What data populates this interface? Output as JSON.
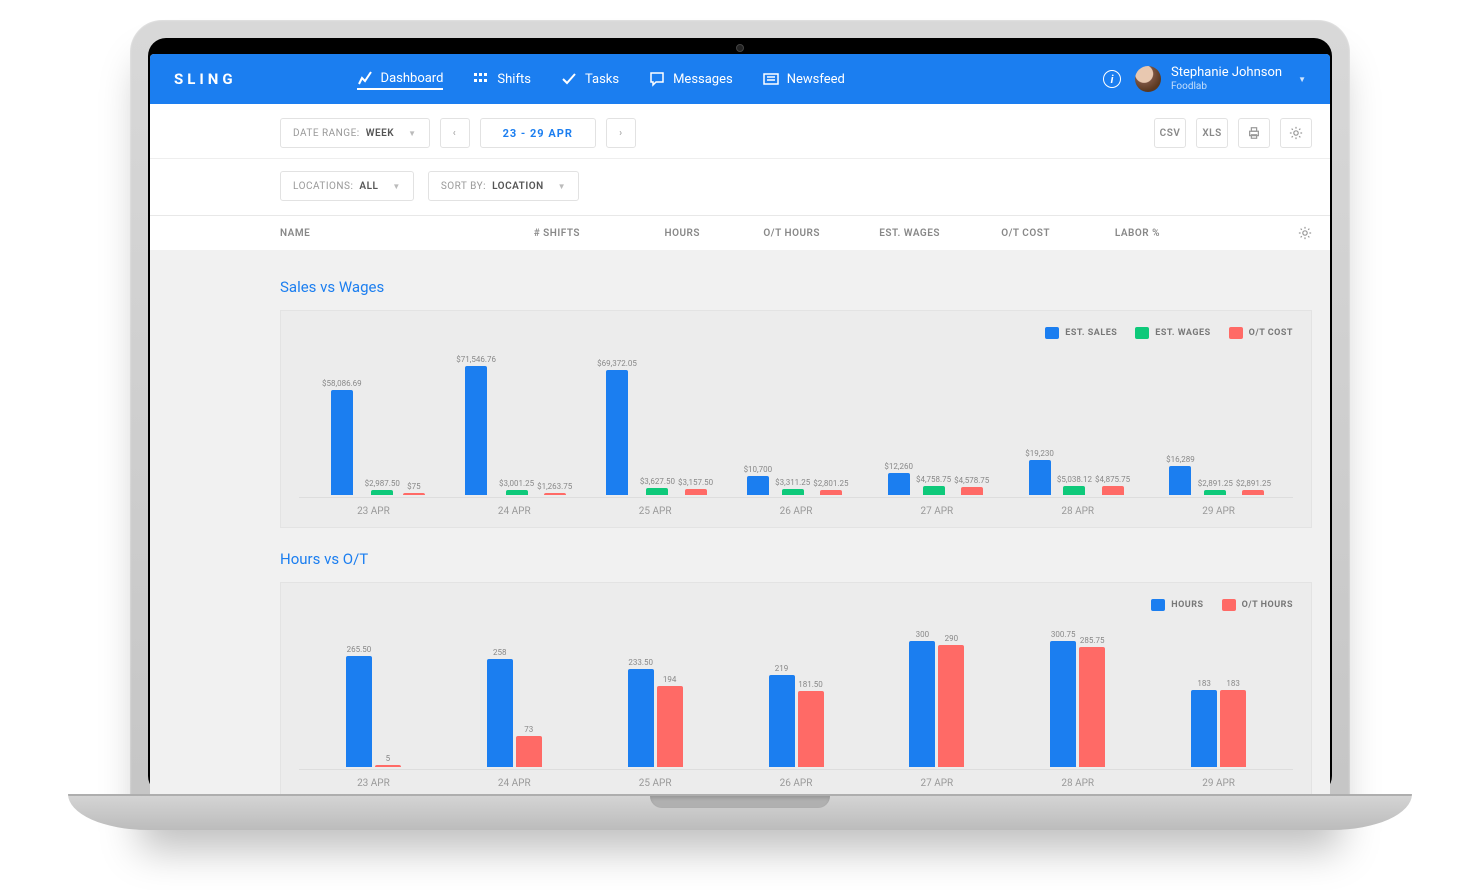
{
  "brand": "SLING",
  "nav": {
    "dashboard": "Dashboard",
    "shifts": "Shifts",
    "tasks": "Tasks",
    "messages": "Messages",
    "newsfeed": "Newsfeed"
  },
  "user": {
    "name": "Stephanie Johnson",
    "company": "Foodlab"
  },
  "toolbar": {
    "dateRangeLabel": "DATE RANGE:",
    "dateRangeValue": "WEEK",
    "range": "23 - 29 APR",
    "csv": "CSV",
    "xls": "XLS",
    "locationsLabel": "LOCATIONS:",
    "locationsValue": "ALL",
    "sortLabel": "SORT BY:",
    "sortValue": "LOCATION"
  },
  "columns": {
    "name": "NAME",
    "shifts": "# SHIFTS",
    "hours": "HOURS",
    "ot": "O/T HOURS",
    "wages": "EST. WAGES",
    "otcost": "O/T COST",
    "labor": "LABOR %"
  },
  "charts": {
    "sales": {
      "title": "Sales vs Wages",
      "legend": {
        "sales": "EST. SALES",
        "wages": "EST. WAGES",
        "ot": "O/T COST"
      }
    },
    "hours": {
      "title": "Hours vs O/T",
      "legend": {
        "hours": "HOURS",
        "ot": "O/T HOURS"
      }
    }
  },
  "colors": {
    "blue": "#1b7ef0",
    "green": "#0ec97a",
    "red": "#ff6a66"
  },
  "chart_data": [
    {
      "type": "bar",
      "title": "Sales vs Wages",
      "categories": [
        "23 APR",
        "24 APR",
        "25 APR",
        "26 APR",
        "27 APR",
        "28 APR",
        "29 APR"
      ],
      "series": [
        {
          "name": "EST. SALES",
          "labels": [
            "$58,086.69",
            "$71,546.76",
            "$69,372.05",
            "$10,700",
            "$12,260",
            "$19,230",
            "$16,289"
          ],
          "values": [
            58086.69,
            71546.76,
            69372.05,
            10700,
            12260,
            19230,
            16289
          ]
        },
        {
          "name": "EST. WAGES",
          "labels": [
            "$2,987.50",
            "$3,001.25",
            "$3,627.50",
            "$3,311.25",
            "$4,758.75",
            "$5,038.12",
            "$2,891.25"
          ],
          "values": [
            2987.5,
            3001.25,
            3627.5,
            3311.25,
            4758.75,
            5038.12,
            2891.25
          ]
        },
        {
          "name": "O/T COST",
          "labels": [
            "$75",
            "$1,263.75",
            "$3,157.50",
            "$2,801.25",
            "$4,578.75",
            "$4,875.75",
            "$2,891.25"
          ],
          "values": [
            75,
            1263.75,
            3157.5,
            2801.25,
            4578.75,
            4875.75,
            2891.25
          ]
        }
      ],
      "ylim": [
        0,
        72000
      ]
    },
    {
      "type": "bar",
      "title": "Hours vs O/T",
      "categories": [
        "23 APR",
        "24 APR",
        "25 APR",
        "26 APR",
        "27 APR",
        "28 APR",
        "29 APR"
      ],
      "series": [
        {
          "name": "HOURS",
          "labels": [
            "265.50",
            "258",
            "233.50",
            "219",
            "300",
            "300.75",
            "183"
          ],
          "values": [
            265.5,
            258,
            233.5,
            219,
            300,
            300.75,
            183
          ]
        },
        {
          "name": "O/T HOURS",
          "labels": [
            "5",
            "73",
            "194",
            "181.50",
            "290",
            "285.75",
            "183"
          ],
          "values": [
            5,
            73,
            194,
            181.5,
            290,
            285.75,
            183
          ]
        }
      ],
      "ylim": [
        0,
        310
      ]
    }
  ]
}
